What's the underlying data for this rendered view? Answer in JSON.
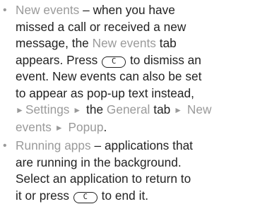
{
  "items": [
    {
      "lines": [
        {
          "title": "New events",
          "sep": " – ",
          "text": "when you have"
        },
        {
          "text": "missed a call or received a new"
        },
        {
          "pre": "message, the ",
          "hl": "New events",
          "post": " tab"
        },
        {
          "pre": "appears. Press ",
          "key": "C",
          "post": " to dismiss an"
        },
        {
          "text": "event. New events can also be set"
        },
        {
          "text": "to appear as pop-up text instead,"
        },
        {
          "menu1": "Settings",
          "mid": " the ",
          "tab": "General",
          "tail": " tab ",
          "menu2": "New"
        },
        {
          "menu3": "events",
          "menu4": "Popup",
          "end": "."
        }
      ]
    },
    {
      "lines": [
        {
          "title": "Running apps",
          "sep": " – ",
          "text": "applications that"
        },
        {
          "text": "are running in the background."
        },
        {
          "text": "Select an application to return to"
        },
        {
          "pre": "it or press ",
          "key": "C",
          "post": " to end it."
        }
      ]
    }
  ]
}
